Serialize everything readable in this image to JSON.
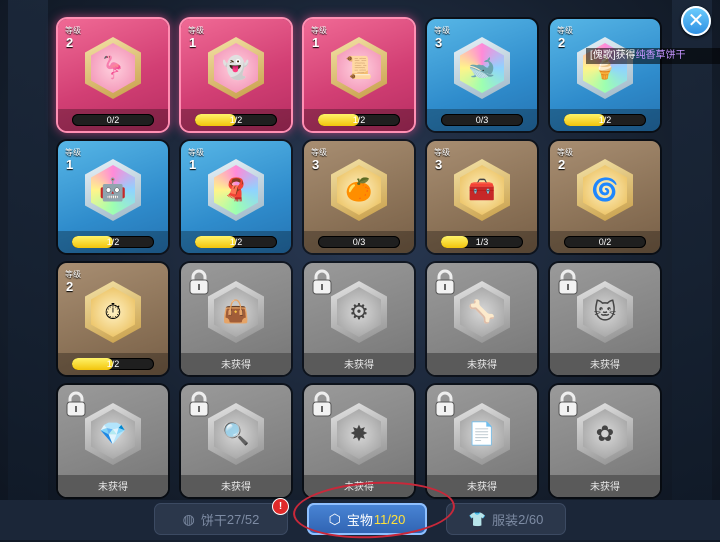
{
  "notice": {
    "prefix": "[",
    "name": "傀歌",
    "mid": "]获得",
    "item": "纯香草饼干"
  },
  "lock_label": "未获得",
  "level_caption": "等级",
  "cards": [
    {
      "rarity": "red",
      "level": "2",
      "icon": "flamingo-icon",
      "glyph": "🦩",
      "progress": "0/2",
      "fill": 0
    },
    {
      "rarity": "red",
      "level": "1",
      "icon": "ghost-icon",
      "glyph": "👻",
      "progress": "1/2",
      "fill": 0.5
    },
    {
      "rarity": "red",
      "level": "1",
      "icon": "map-scroll-icon",
      "glyph": "📜",
      "progress": "1/2",
      "fill": 0.5
    },
    {
      "rarity": "blue",
      "level": "3",
      "icon": "whale-icon",
      "glyph": "🐋",
      "progress": "0/3",
      "fill": 0
    },
    {
      "rarity": "blue",
      "level": "2",
      "icon": "ice-cream-icon",
      "glyph": "🍦",
      "progress": "1/2",
      "fill": 0.5
    },
    {
      "rarity": "blue",
      "level": "1",
      "icon": "robot-head-icon",
      "glyph": "🤖",
      "progress": "1/2",
      "fill": 0.5
    },
    {
      "rarity": "blue",
      "level": "1",
      "icon": "cloth-icon",
      "glyph": "🧣",
      "progress": "1/2",
      "fill": 0.5
    },
    {
      "rarity": "brown",
      "level": "3",
      "icon": "orange-slime-icon",
      "glyph": "🍊",
      "progress": "0/3",
      "fill": 0
    },
    {
      "rarity": "brown",
      "level": "3",
      "icon": "treasure-chest-icon",
      "glyph": "🧰",
      "progress": "1/3",
      "fill": 0.333
    },
    {
      "rarity": "brown",
      "level": "2",
      "icon": "purple-roll-icon",
      "glyph": "🌀",
      "progress": "0/2",
      "fill": 0
    },
    {
      "rarity": "brown",
      "level": "2",
      "icon": "pocket-watch-icon",
      "glyph": "⏱",
      "progress": "1/2",
      "fill": 0.5
    },
    {
      "rarity": "gray",
      "locked": true,
      "icon": "bag-icon",
      "glyph": "👜"
    },
    {
      "rarity": "gray",
      "locked": true,
      "icon": "gear-creature-icon",
      "glyph": "⚙"
    },
    {
      "rarity": "gray",
      "locked": true,
      "icon": "bone-icon",
      "glyph": "🦴"
    },
    {
      "rarity": "gray",
      "locked": true,
      "icon": "cat-mask-icon",
      "glyph": "🐱"
    },
    {
      "rarity": "gray",
      "locked": true,
      "icon": "gem-icon",
      "glyph": "💎"
    },
    {
      "rarity": "gray",
      "locked": true,
      "icon": "magnifier-icon",
      "glyph": "🔍"
    },
    {
      "rarity": "gray",
      "locked": true,
      "icon": "splash-icon",
      "glyph": "✸"
    },
    {
      "rarity": "gray",
      "locked": true,
      "icon": "scroll-document-icon",
      "glyph": "📄"
    },
    {
      "rarity": "gray",
      "locked": true,
      "icon": "flower-badge-icon",
      "glyph": "✿"
    }
  ],
  "tabs": {
    "cookies": {
      "label": "饼干",
      "count": "27/52",
      "icon": "cookie-icon"
    },
    "treasures": {
      "label": "宝物",
      "count": "11/20",
      "icon": "treasure-hex-icon"
    },
    "costumes": {
      "label": "服装",
      "count": "2/60",
      "icon": "shirt-icon"
    }
  },
  "badge": "!",
  "close_glyph": "✕",
  "colors": {
    "highlight": "#c795ff",
    "count_highlight": "#ffe03a",
    "annotation_circle": "#c9283a"
  }
}
